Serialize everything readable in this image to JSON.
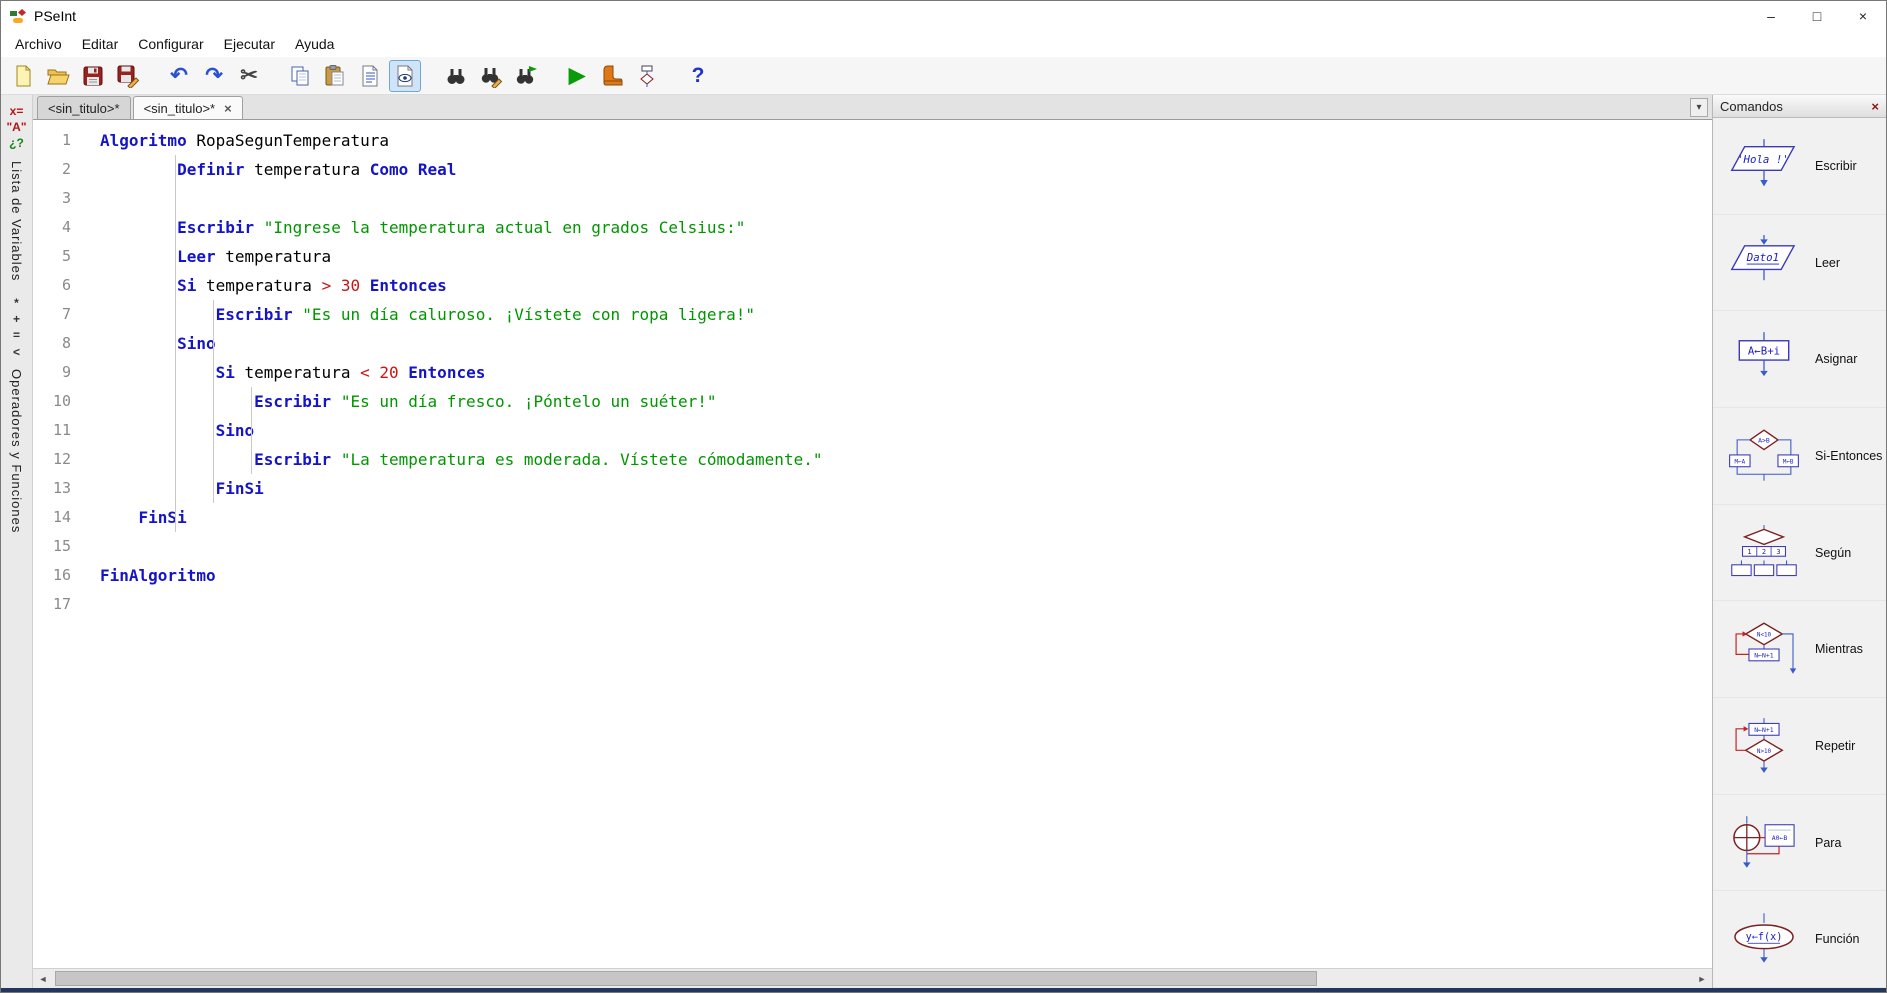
{
  "window": {
    "title": "PSeInt"
  },
  "menu": {
    "items": [
      "Archivo",
      "Editar",
      "Configurar",
      "Ejecutar",
      "Ayuda"
    ]
  },
  "toolbar": {
    "icons": [
      "new-file",
      "open-file",
      "save-file",
      "save-as",
      "undo",
      "redo",
      "cut",
      "copy",
      "paste",
      "document-lines",
      "view-options",
      "find",
      "find-replace",
      "find-next",
      "run",
      "step-run",
      "draw-flowchart",
      "help"
    ],
    "pressed_icon": "view-options"
  },
  "tabs": [
    {
      "label": "<sin_titulo>*",
      "active": false
    },
    {
      "label": "<sin_titulo>*",
      "active": true
    }
  ],
  "left_rail": {
    "variables_tab": {
      "label": "Lista de Variables",
      "glyphs": [
        {
          "t": "x=",
          "c": "#b41414"
        },
        {
          "t": "\"A\"",
          "c": "#b41414"
        },
        {
          "t": "¿?",
          "c": "#148414"
        }
      ]
    },
    "operators_tab": {
      "label": "Operadores y Funciones",
      "glyphs": [
        {
          "t": "*",
          "c": "#333333"
        },
        {
          "t": "+",
          "c": "#333333"
        },
        {
          "t": "=",
          "c": "#333333"
        },
        {
          "t": "<",
          "c": "#333333"
        }
      ]
    }
  },
  "editor": {
    "language": "pseudocode",
    "lines": [
      {
        "n": 1,
        "indent": 0,
        "tokens": [
          [
            "kw",
            "Algoritmo"
          ],
          [
            "pl",
            " RopaSegunTemperatura"
          ]
        ]
      },
      {
        "n": 2,
        "indent": 8,
        "tokens": [
          [
            "kw",
            "Definir"
          ],
          [
            "pl",
            " temperatura "
          ],
          [
            "kw",
            "Como"
          ],
          [
            "pl",
            " "
          ],
          [
            "kw",
            "Real"
          ]
        ]
      },
      {
        "n": 3,
        "indent": 0,
        "tokens": []
      },
      {
        "n": 4,
        "indent": 8,
        "tokens": [
          [
            "kw",
            "Escribir"
          ],
          [
            "pl",
            " "
          ],
          [
            "str",
            "\"Ingrese la temperatura actual en grados Celsius:\""
          ]
        ]
      },
      {
        "n": 5,
        "indent": 8,
        "tokens": [
          [
            "kw",
            "Leer"
          ],
          [
            "pl",
            " temperatura"
          ]
        ]
      },
      {
        "n": 6,
        "indent": 8,
        "tokens": [
          [
            "kw",
            "Si"
          ],
          [
            "pl",
            " temperatura "
          ],
          [
            "op",
            ">"
          ],
          [
            "pl",
            " "
          ],
          [
            "num",
            "30"
          ],
          [
            "pl",
            " "
          ],
          [
            "kw",
            "Entonces"
          ]
        ]
      },
      {
        "n": 7,
        "indent": 12,
        "tokens": [
          [
            "kw",
            "Escribir"
          ],
          [
            "pl",
            " "
          ],
          [
            "str",
            "\"Es un día caluroso. ¡Vístete con ropa ligera!\""
          ]
        ]
      },
      {
        "n": 8,
        "indent": 8,
        "tokens": [
          [
            "kw",
            "Sino"
          ]
        ]
      },
      {
        "n": 9,
        "indent": 12,
        "tokens": [
          [
            "kw",
            "Si"
          ],
          [
            "pl",
            " temperatura "
          ],
          [
            "op",
            "<"
          ],
          [
            "pl",
            " "
          ],
          [
            "num",
            "20"
          ],
          [
            "pl",
            " "
          ],
          [
            "kw",
            "Entonces"
          ]
        ]
      },
      {
        "n": 10,
        "indent": 16,
        "tokens": [
          [
            "kw",
            "Escribir"
          ],
          [
            "pl",
            " "
          ],
          [
            "str",
            "\"Es un día fresco. ¡Póntelo un suéter!\""
          ]
        ]
      },
      {
        "n": 11,
        "indent": 12,
        "tokens": [
          [
            "kw",
            "Sino"
          ]
        ]
      },
      {
        "n": 12,
        "indent": 16,
        "tokens": [
          [
            "kw",
            "Escribir"
          ],
          [
            "pl",
            " "
          ],
          [
            "str",
            "\"La temperatura es moderada. Vístete cómodamente.\""
          ]
        ]
      },
      {
        "n": 13,
        "indent": 12,
        "tokens": [
          [
            "kw",
            "FinSi"
          ]
        ]
      },
      {
        "n": 14,
        "indent": 4,
        "tokens": [
          [
            "kw",
            "FinSi"
          ]
        ]
      },
      {
        "n": 15,
        "indent": 0,
        "tokens": []
      },
      {
        "n": 16,
        "indent": 0,
        "tokens": [
          [
            "kw",
            "FinAlgoritmo"
          ]
        ]
      },
      {
        "n": 17,
        "indent": 0,
        "tokens": []
      }
    ]
  },
  "commands_panel": {
    "title": "Comandos",
    "items": [
      {
        "label": "Escribir",
        "icon": "write-output-flowchart-icon",
        "texts": [
          "'Hola !'"
        ]
      },
      {
        "label": "Leer",
        "icon": "read-input-flowchart-icon",
        "texts": [
          "Dato1"
        ]
      },
      {
        "label": "Asignar",
        "icon": "assign-flowchart-icon",
        "texts": [
          "A←B+i"
        ]
      },
      {
        "label": "Si-Entonces",
        "icon": "if-then-flowchart-icon",
        "texts": [
          "A>B",
          "M←A",
          "M←B"
        ]
      },
      {
        "label": "Según",
        "icon": "switch-flowchart-icon",
        "texts": [
          "1",
          "2",
          "3"
        ]
      },
      {
        "label": "Mientras",
        "icon": "while-flowchart-icon",
        "texts": [
          "N<10",
          "N←N+1"
        ]
      },
      {
        "label": "Repetir",
        "icon": "repeat-flowchart-icon",
        "texts": [
          "N←N+1",
          "N>10"
        ]
      },
      {
        "label": "Para",
        "icon": "for-flowchart-icon",
        "texts": [
          "A0←B"
        ]
      },
      {
        "label": "Función",
        "icon": "function-flowchart-icon",
        "texts": [
          "y←f(x)"
        ]
      }
    ]
  },
  "colors": {
    "keyword": "#1414c8",
    "string": "#009600",
    "number": "#c81414",
    "operator": "#c81414",
    "pressed_bg": "#cfe4f7"
  }
}
